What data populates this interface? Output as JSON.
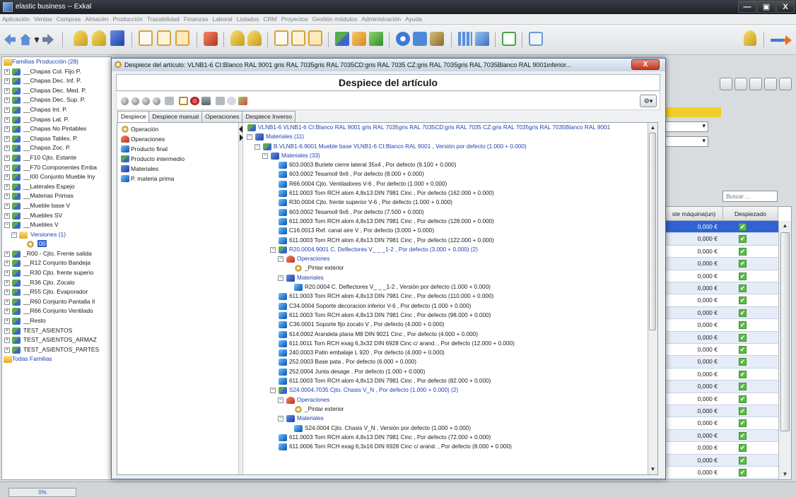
{
  "app": {
    "title": "elastic business -- Exkal",
    "window_buttons": [
      "—",
      "▣",
      "X"
    ]
  },
  "menu": [
    "Aplicación",
    "Ventas",
    "Compras",
    "Almacén",
    "Producción",
    "Trazabilidad",
    "Finanzas",
    "Laboral",
    "Listados",
    "CRM",
    "Proyectos",
    "Gestión módulos",
    "Administración",
    "Ayuda"
  ],
  "family_tree": {
    "header": "Familias Producción (28)",
    "items": [
      {
        "label": "__Chapas Col. Fijo P.",
        "exp": "+",
        "icon": "multi"
      },
      {
        "label": "__Chapas Dec. Inf. P.",
        "exp": "+",
        "icon": "multi"
      },
      {
        "label": "__Chapas Dec. Med. P.",
        "exp": "+",
        "icon": "multi"
      },
      {
        "label": "__Chapas Dec. Sup. P.",
        "exp": "+",
        "icon": "multi"
      },
      {
        "label": "__Chapas Int. P.",
        "exp": "+",
        "icon": "multi"
      },
      {
        "label": "__Chapas Lat. P.",
        "exp": "+",
        "icon": "multi"
      },
      {
        "label": "__Chapas No Pintables",
        "exp": "+",
        "icon": "multi"
      },
      {
        "label": "__Chapas Tablex. P.",
        "exp": "+",
        "icon": "multi"
      },
      {
        "label": "__Chapas Zoc. P.",
        "exp": "+",
        "icon": "multi"
      },
      {
        "label": "__F10 Cjto. Estante",
        "exp": "+",
        "icon": "multi"
      },
      {
        "label": "__F70 Componentes Emba",
        "exp": "+",
        "icon": "multi"
      },
      {
        "label": "__I00 Conjunto Mueble Iny",
        "exp": "+",
        "icon": "multi"
      },
      {
        "label": "__Laterales Espejo",
        "exp": "+",
        "icon": "multi"
      },
      {
        "label": "__Materias Primas",
        "exp": "+",
        "icon": "multi"
      },
      {
        "label": "__Mueble base V",
        "exp": "+",
        "icon": "multi"
      },
      {
        "label": "__Muebles SV",
        "exp": "+",
        "icon": "multi"
      },
      {
        "label": "__Muebles V",
        "exp": "−",
        "icon": "multi"
      },
      {
        "label": "Versiones (1)",
        "exp": "−",
        "icon": "folder",
        "indent": 1,
        "blue": true
      },
      {
        "label": "00",
        "exp": "",
        "icon": "gear",
        "indent": 2,
        "selected": true
      },
      {
        "label": "_R00 - Cjto. Frente salida",
        "exp": "+",
        "icon": "multi"
      },
      {
        "label": "__R12 Conjunto Bandeja",
        "exp": "+",
        "icon": "multi"
      },
      {
        "label": "__R30 Cjto. frente superio",
        "exp": "+",
        "icon": "multi"
      },
      {
        "label": "__R36 Cjto. Zocalo",
        "exp": "+",
        "icon": "multi"
      },
      {
        "label": "__R55 Cjto. Evaporador",
        "exp": "+",
        "icon": "multi"
      },
      {
        "label": "__R60 Conjunto Pantalla Il",
        "exp": "+",
        "icon": "multi"
      },
      {
        "label": "__R66 Conjunto Ventilado",
        "exp": "+",
        "icon": "multi"
      },
      {
        "label": "__Resto",
        "exp": "+",
        "icon": "multi"
      },
      {
        "label": "TEST_ASIENTOS",
        "exp": "+",
        "icon": "multi"
      },
      {
        "label": "TEST_ASIENTOS_ARMAZ",
        "exp": "+",
        "icon": "multi"
      },
      {
        "label": "TEST_ASIENTOS_PARTES",
        "exp": "+",
        "icon": "multi"
      }
    ],
    "footer": "Todas Familias"
  },
  "right_panel": {
    "search_placeholder": "Buscar ...",
    "col_cost": "ste máquina(un)",
    "col_exploded": "Despiezado",
    "rows": [
      "0,000 €",
      "0,000 €",
      "0,000 €",
      "0,000 €",
      "0,000 €",
      "0,000 €",
      "0,000 €",
      "0,000 €",
      "0,000 €",
      "0,000 €",
      "0,000 €",
      "0,000 €",
      "0,000 €",
      "0,000 €",
      "0,000 €",
      "0,000 €",
      "0,000 €",
      "0,000 €",
      "0,000 €",
      "0,000 €",
      "0,000 €"
    ],
    "checkmark": "✔"
  },
  "status": {
    "progress_text": "0%",
    "progress": 0
  },
  "dialog": {
    "title": "Despiece del artículo: VLNB1-6 CI:Blanco RAL 9001 gris RAL 7035gris RAL 7035CD:gris RAL 7035 CZ:gris RAL 7035gris RAL 7035Blanco RAL 9001inferior...",
    "close_label": "X",
    "header": "Despiece del artículo",
    "options_label": "⚙▾",
    "tabs": [
      "Despiece",
      "Despiece manual",
      "Operaciones",
      "Despiece Inverso"
    ],
    "legend": [
      {
        "label": "Operación",
        "icon": "gear"
      },
      {
        "label": "Operaciones",
        "icon": "red"
      },
      {
        "label": "Producto final",
        "icon": "cube"
      },
      {
        "label": "Producto intermedio",
        "icon": "multi"
      },
      {
        "label": "Materiales",
        "icon": "blue"
      },
      {
        "label": "P. materia prima",
        "icon": "cube"
      }
    ],
    "tree": [
      {
        "t": "VLNB1-6 VLNB1-6 CI:Blanco RAL 9001 gris RAL 7035gris RAL 7035CD:gris RAL 7035 CZ:gris RAL 7035gris RAL 7035Blanco RAL 9001",
        "lvl": 0,
        "icon": "multi",
        "exp": "",
        "blue": true
      },
      {
        "t": "Materiales (11)",
        "lvl": 1,
        "icon": "blue",
        "exp": "−",
        "blue": true
      },
      {
        "t": "B.VLNB1-6.9001 Mueble base VLNB1-6 CI:Blanco RAL 9001 , Versión por defecto (1.000 + 0.000)",
        "lvl": 2,
        "icon": "multi",
        "exp": "−",
        "blue": true
      },
      {
        "t": "Materiales (33)",
        "lvl": 3,
        "icon": "blue",
        "exp": "−",
        "blue": true
      },
      {
        "t": "603.0003 Burlete cierre lateral 35x4 , Por defecto (9.100 + 0.000)",
        "lvl": 4,
        "icon": "cube",
        "exp": ""
      },
      {
        "t": "603.0002 Tesamoll 9x6 , Por defecto (8.000 + 0.000)",
        "lvl": 4,
        "icon": "cube",
        "exp": ""
      },
      {
        "t": "R66.0004 Cjto. Ventiladores V-6 , Por defecto (1.000 + 0.000)",
        "lvl": 4,
        "icon": "cube",
        "exp": ""
      },
      {
        "t": "611.0003 Torn RCH alom 4,8x13 DIN 7981 Cinc , Por defecto (162.000 + 0.000)",
        "lvl": 4,
        "icon": "cube",
        "exp": ""
      },
      {
        "t": "R30.0004 Cjto. frente superior V-6 , Por defecto (1.000 + 0.000)",
        "lvl": 4,
        "icon": "cube",
        "exp": ""
      },
      {
        "t": "603.0002 Tesamoll 9x6 , Por defecto (7.500 + 0.000)",
        "lvl": 4,
        "icon": "cube",
        "exp": ""
      },
      {
        "t": "611.0003 Torn RCH alom 4,8x13 DIN 7981 Cinc , Por defecto (128.000 + 0.000)",
        "lvl": 4,
        "icon": "cube",
        "exp": ""
      },
      {
        "t": "C16.0013 Ref. canal aire V , Por defecto (3.000 + 0.000)",
        "lvl": 4,
        "icon": "cube",
        "exp": ""
      },
      {
        "t": "611.0003 Torn RCH alom 4,8x13 DIN 7981 Cinc , Por defecto (122.000 + 0.000)",
        "lvl": 4,
        "icon": "cube",
        "exp": ""
      },
      {
        "t": "R20.0004.9001 C. Deflectores V_ _ _1-2 , Por defecto (3.000 + 0.000) (2)",
        "lvl": 4,
        "icon": "multi",
        "exp": "−",
        "blue": true
      },
      {
        "t": "Operaciones",
        "lvl": 5,
        "icon": "red",
        "exp": "−",
        "blue": true
      },
      {
        "t": "_Pintar exterior",
        "lvl": 6,
        "icon": "gear",
        "exp": ""
      },
      {
        "t": "Materiales",
        "lvl": 5,
        "icon": "blue",
        "exp": "−",
        "blue": true
      },
      {
        "t": "R20.0004 C. Deflectores V_ _ _1-2 , Versión por defecto (1.000 + 0.000)",
        "lvl": 6,
        "icon": "cube",
        "exp": ""
      },
      {
        "t": "611.0003 Torn RCH alom 4,8x13 DIN 7981 Cinc , Por defecto (110.000 + 0.000)",
        "lvl": 4,
        "icon": "cube",
        "exp": ""
      },
      {
        "t": "C34.0004 Soporte decoracion inferior V-6 , Por defecto (1.000 + 0.000)",
        "lvl": 4,
        "icon": "cube",
        "exp": ""
      },
      {
        "t": "611.0003 Torn RCH alom 4,8x13 DIN 7981 Cinc , Por defecto (98.000 + 0.000)",
        "lvl": 4,
        "icon": "cube",
        "exp": ""
      },
      {
        "t": "C36.0001 Soporte fijo zocalo V , Por defecto (4.000 + 0.000)",
        "lvl": 4,
        "icon": "cube",
        "exp": ""
      },
      {
        "t": "614.0002 Arandela plana M8 DIN 9021 Cinc , Por defecto (4.000 + 0.000)",
        "lvl": 4,
        "icon": "cube",
        "exp": ""
      },
      {
        "t": "611.0011 Torn RCH exag 6,3x32 DIN 6928 Cinc c/ arand. , Por defecto (12.000 + 0.000)",
        "lvl": 4,
        "icon": "cube",
        "exp": ""
      },
      {
        "t": "240.0003 Patin embalaje L 920 , Por defecto (4.000 + 0.000)",
        "lvl": 4,
        "icon": "cube",
        "exp": ""
      },
      {
        "t": "252.0003 Base pata , Por defecto (6.000 + 0.000)",
        "lvl": 4,
        "icon": "cube",
        "exp": ""
      },
      {
        "t": "252.0004 Junta desage , Por defecto (1.000 + 0.000)",
        "lvl": 4,
        "icon": "cube",
        "exp": ""
      },
      {
        "t": "611.0003 Torn RCH alom 4,8x13 DIN 7981 Cinc , Por defecto (82.000 + 0.000)",
        "lvl": 4,
        "icon": "cube",
        "exp": ""
      },
      {
        "t": "S24.0004.7035 Cjto. Chasis V_N , Por defecto (1.000 + 0.000) (2)",
        "lvl": 4,
        "icon": "multi",
        "exp": "−",
        "blue": true
      },
      {
        "t": "Operaciones",
        "lvl": 5,
        "icon": "red",
        "exp": "−",
        "blue": true
      },
      {
        "t": "_Pintar exterior",
        "lvl": 6,
        "icon": "gear",
        "exp": ""
      },
      {
        "t": "Materiales",
        "lvl": 5,
        "icon": "blue",
        "exp": "−",
        "blue": true
      },
      {
        "t": "S24.0004 Cjto. Chasis V_N , Versión por defecto (1.000 + 0.000)",
        "lvl": 6,
        "icon": "cube",
        "exp": ""
      },
      {
        "t": "611.0003 Torn RCH alom 4,8x13 DIN 7981 Cinc , Por defecto (72.000 + 0.000)",
        "lvl": 4,
        "icon": "cube",
        "exp": ""
      },
      {
        "t": "611.0006 Torn RCH exag 6,3x16 DIN 6928 Cinc c/ arand. , Por defecto (8.000 + 0.000)",
        "lvl": 4,
        "icon": "cube",
        "exp": ""
      }
    ]
  }
}
